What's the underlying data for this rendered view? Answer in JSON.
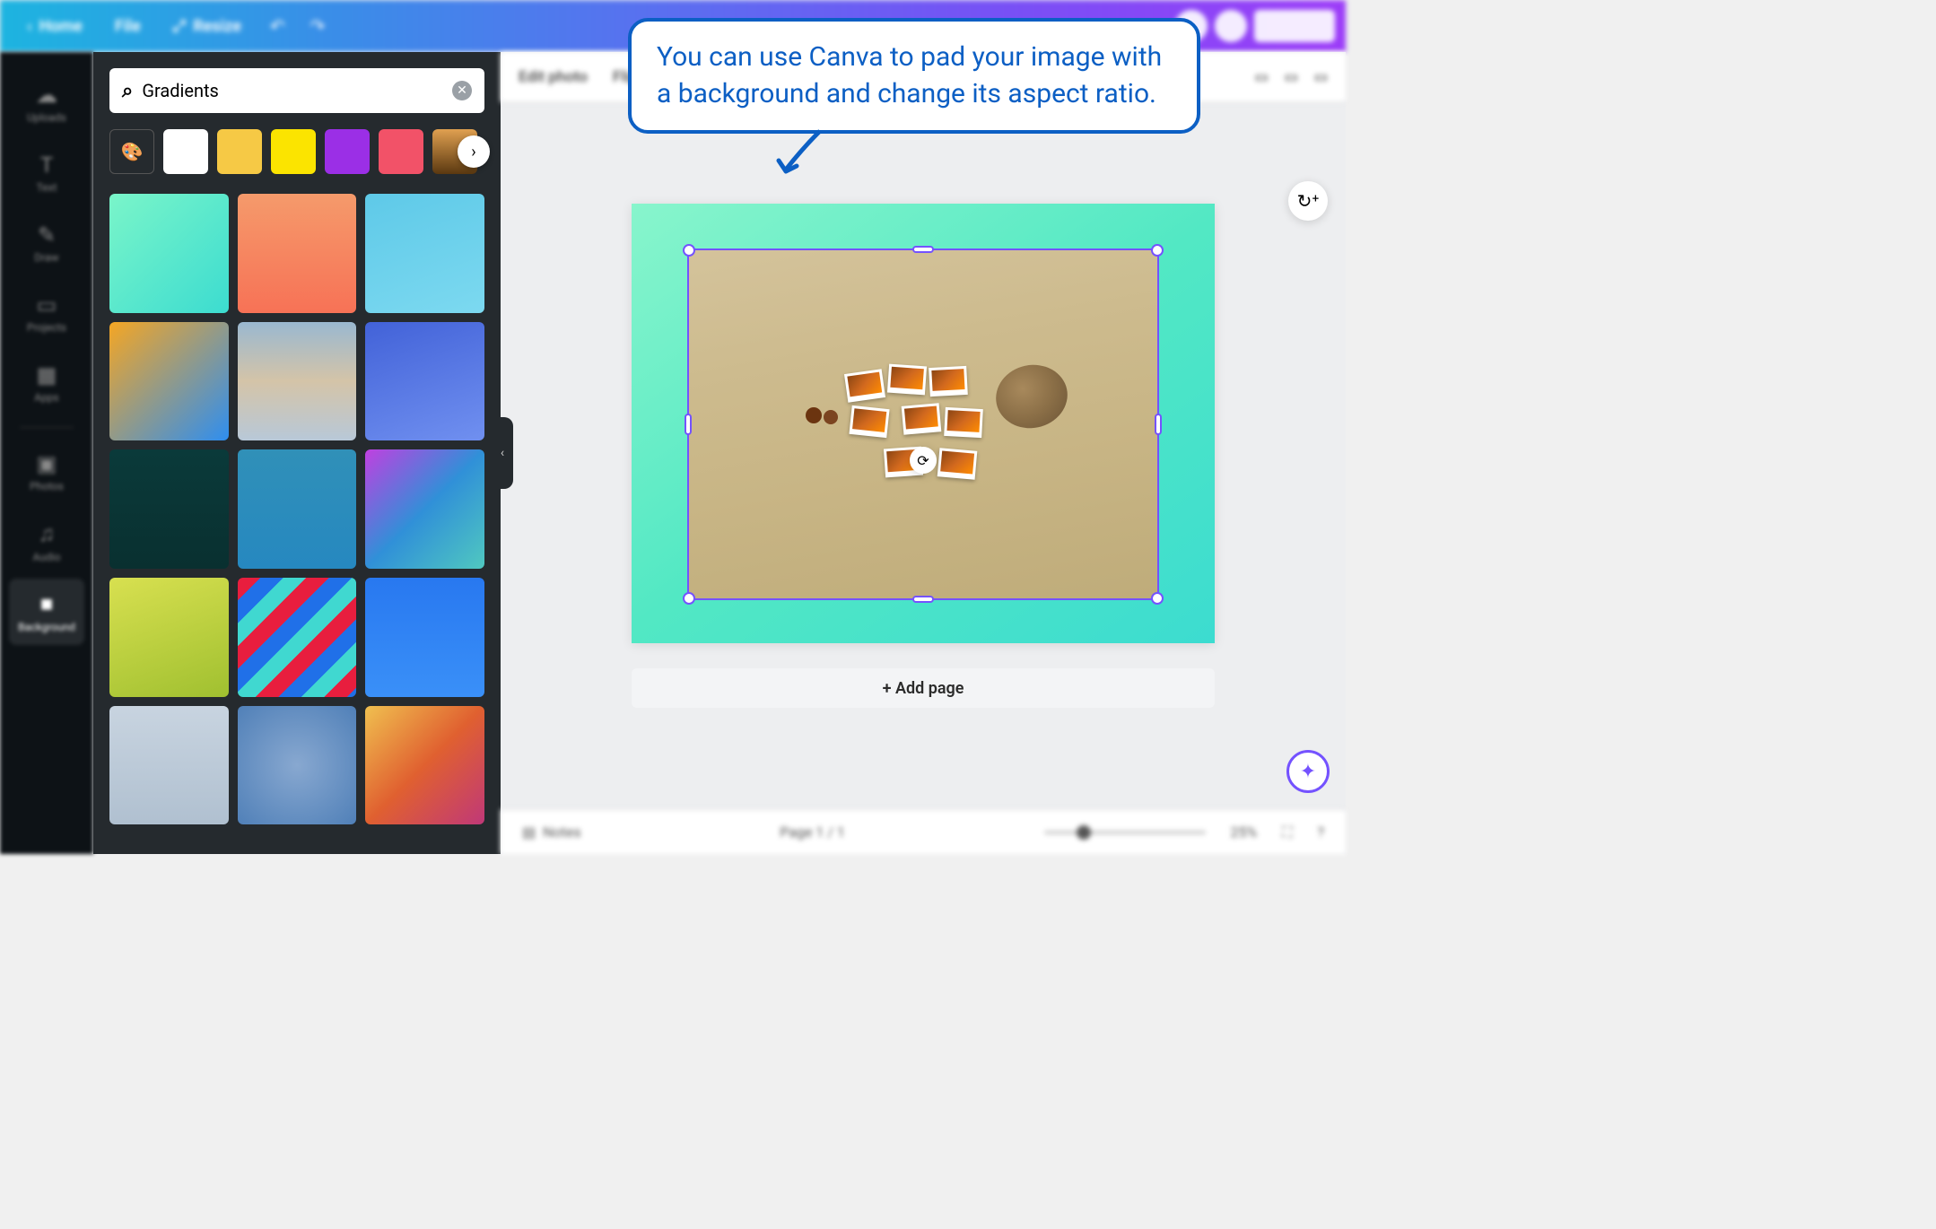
{
  "topbar": {
    "home": "Home",
    "file": "File",
    "resize": "Resize"
  },
  "rail": {
    "uploads": "Uploads",
    "text": "Text",
    "draw": "Draw",
    "projects": "Projects",
    "apps": "Apps",
    "photos": "Photos",
    "audio": "Audio",
    "background": "Background"
  },
  "panel": {
    "search_value": "Gradients",
    "colors": [
      "#ffffff",
      "#f6c945",
      "#fbe400",
      "#9b2fe6",
      "#f25268"
    ]
  },
  "canvas_toolbar": {
    "edit_photo": "Edit photo",
    "flip": "Flip"
  },
  "canvas": {
    "add_page": "+ Add page"
  },
  "bottombar": {
    "notes": "Notes",
    "page_indicator": "Page 1 / 1",
    "zoom": "25%"
  },
  "callout": {
    "text": "You can use Canva to pad your image with a background and change its aspect ratio."
  }
}
